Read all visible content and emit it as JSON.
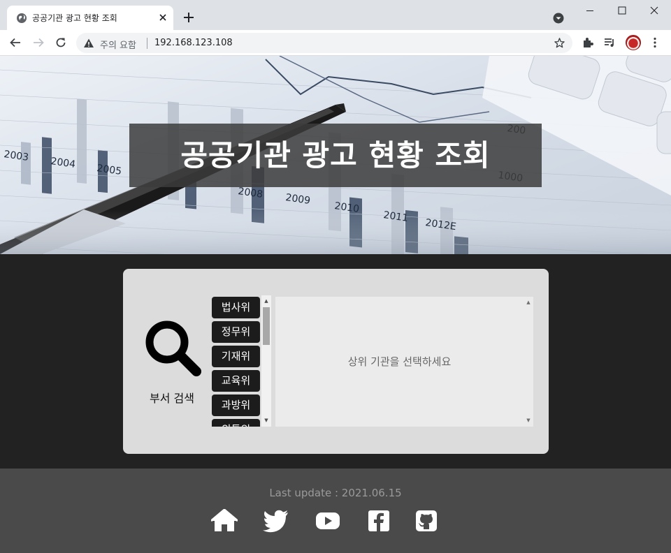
{
  "browser": {
    "tab_title": "공공기관 광고 현황 조회",
    "security_warning": "주의 요함",
    "url": "192.168.123.108"
  },
  "hero": {
    "title": "공공기관 광고 현황 조회",
    "background_labels": [
      "2003",
      "2004",
      "2005",
      "2008",
      "2009",
      "2010",
      "2011",
      "2012E",
      "1000",
      "200"
    ]
  },
  "search": {
    "label": "부서 검색",
    "departments": [
      "법사위",
      "정무위",
      "기재위",
      "교육위",
      "과방위",
      "외통위"
    ],
    "placeholder": "상위 기관을 선택하세요"
  },
  "footer": {
    "last_update": "Last update : 2021.06.15",
    "links": [
      "home-icon",
      "twitter-icon",
      "youtube-icon",
      "facebook-icon",
      "github-icon"
    ]
  },
  "colors": {
    "accent": "#1c1c1c",
    "panel": "#dcdcdc",
    "footer": "#4a4a4a"
  }
}
